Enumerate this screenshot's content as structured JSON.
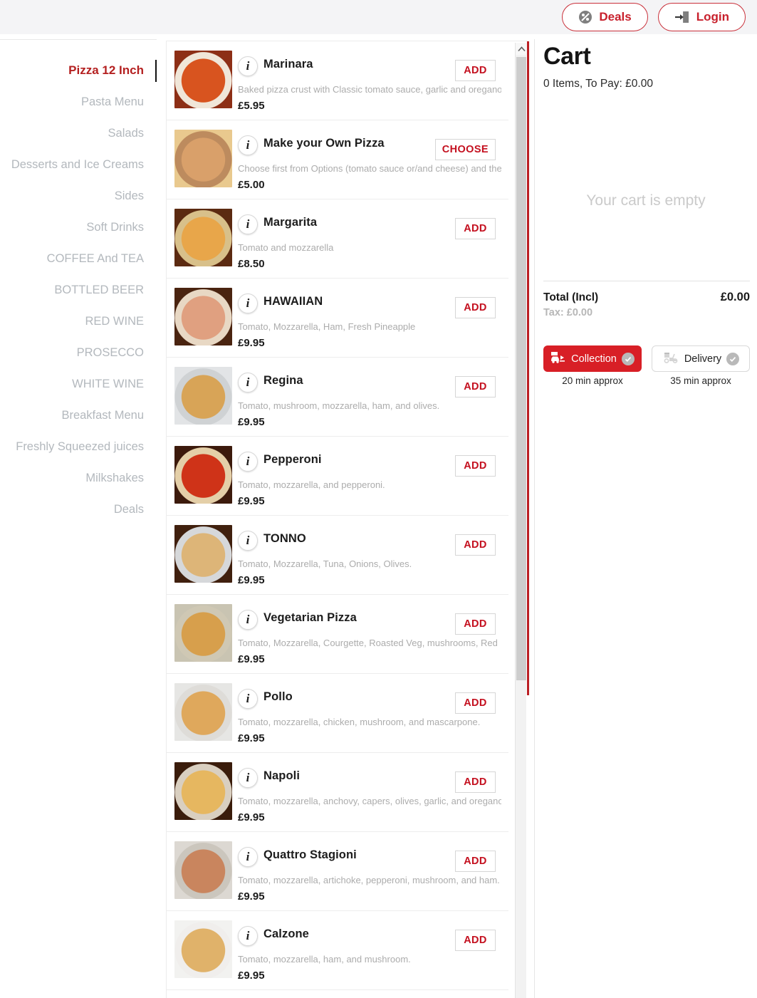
{
  "header": {
    "deals_label": "Deals",
    "deals_icon": "percent-badge-icon",
    "login_label": "Login",
    "login_icon": "login-arrow-icon"
  },
  "sidebar": {
    "items": [
      {
        "label": "Pizza 12 Inch",
        "active": true
      },
      {
        "label": "Pasta Menu",
        "active": false
      },
      {
        "label": "Salads",
        "active": false
      },
      {
        "label": "Desserts and Ice Creams",
        "active": false
      },
      {
        "label": "Sides",
        "active": false
      },
      {
        "label": "Soft Drinks",
        "active": false
      },
      {
        "label": "COFFEE And TEA",
        "active": false
      },
      {
        "label": "BOTTLED BEER",
        "active": false
      },
      {
        "label": "RED WINE",
        "active": false
      },
      {
        "label": "PROSECCO",
        "active": false
      },
      {
        "label": "WHITE WINE",
        "active": false
      },
      {
        "label": "Breakfast Menu",
        "active": false
      },
      {
        "label": "Freshly Squeezed juices",
        "active": false
      },
      {
        "label": "Milkshakes",
        "active": false
      },
      {
        "label": "Deals",
        "active": false
      }
    ]
  },
  "menu": {
    "items": [
      {
        "name": "Marinara",
        "description": "Baked pizza crust with Classic tomato sauce, garlic and oregano.",
        "price": "£5.95",
        "action": "ADD",
        "img_top": "#8d2f16",
        "img_mid": "#d8541f",
        "img_bot": "#f0e6d8"
      },
      {
        "name": "Make your Own Pizza",
        "description": "Choose first from Options (tomato sauce or/and cheese) and then",
        "price": "£5.00",
        "action": "CHOOSE",
        "img_top": "#e9c98e",
        "img_mid": "#d9a06a",
        "img_bot": "#bd8b5e"
      },
      {
        "name": "Margarita",
        "description": "Tomato and mozzarella",
        "price": "£8.50",
        "action": "ADD",
        "img_top": "#5b2a11",
        "img_mid": "#e8a64a",
        "img_bot": "#d8c08a"
      },
      {
        "name": "HAWAIIAN",
        "description": "Tomato, Mozzarella, Ham, Fresh Pineapple",
        "price": "£9.95",
        "action": "ADD",
        "img_top": "#4a2410",
        "img_mid": "#e0a080",
        "img_bot": "#e8d8c4"
      },
      {
        "name": "Regina",
        "description": "Tomato, mushroom, mozzarella, ham, and olives.",
        "price": "£9.95",
        "action": "ADD",
        "img_top": "#e2e4e6",
        "img_mid": "#d8a457",
        "img_bot": "#cfd2d4"
      },
      {
        "name": "Pepperoni",
        "description": "Tomato, mozzarella, and pepperoni.",
        "price": "£9.95",
        "action": "ADD",
        "img_top": "#3c1a0c",
        "img_mid": "#cf3318",
        "img_bot": "#e4cfa8"
      },
      {
        "name": "TONNO",
        "description": "Tomato, Mozzarella, Tuna, Onions, Olives.",
        "price": "£9.95",
        "action": "ADD",
        "img_top": "#40200e",
        "img_mid": "#ddb578",
        "img_bot": "#d6d8da"
      },
      {
        "name": "Vegetarian Pizza",
        "description": "Tomato, Mozzarella, Courgette, Roasted Veg, mushrooms, Red",
        "price": "£9.95",
        "action": "ADD",
        "img_top": "#c9c4b2",
        "img_mid": "#d79f4c",
        "img_bot": "#cfc8b4"
      },
      {
        "name": "Pollo",
        "description": "Tomato, mozzarella, chicken, mushroom, and mascarpone.",
        "price": "£9.95",
        "action": "ADD",
        "img_top": "#e6e6e4",
        "img_mid": "#dfa85c",
        "img_bot": "#dedcd8"
      },
      {
        "name": "Napoli",
        "description": "Tomato, mozzarella, anchovy, capers, olives, garlic, and oregano.",
        "price": "£9.95",
        "action": "ADD",
        "img_top": "#3a1c0b",
        "img_mid": "#e6b760",
        "img_bot": "#d9cfc0"
      },
      {
        "name": "Quattro Stagioni",
        "description": "Tomato, mozzarella, artichoke, pepperoni, mushroom, and ham.",
        "price": "£9.95",
        "action": "ADD",
        "img_top": "#dcd8d2",
        "img_mid": "#c9855e",
        "img_bot": "#cbc6bd"
      },
      {
        "name": "Calzone",
        "description": "Tomato, mozzarella, ham, and mushroom.",
        "price": "£9.95",
        "action": "ADD",
        "img_top": "#f2f2f0",
        "img_mid": "#e0b26a",
        "img_bot": "#f0eeec"
      }
    ]
  },
  "cart": {
    "title": "Cart",
    "summary": "0 Items, To Pay: £0.00",
    "empty_message": "Your cart is empty",
    "total_label": "Total (Incl)",
    "total_value": "£0.00",
    "tax_line": "Tax: £0.00",
    "collection_label": "Collection",
    "collection_eta": "20 min approx",
    "collection_selected": true,
    "delivery_label": "Delivery",
    "delivery_eta": "35 min approx",
    "delivery_selected": false
  },
  "colors": {
    "brand_red": "#c8202c",
    "active_red": "#d81f26",
    "divider_red": "#bb1f24",
    "muted_gray": "#b3b8bd"
  }
}
